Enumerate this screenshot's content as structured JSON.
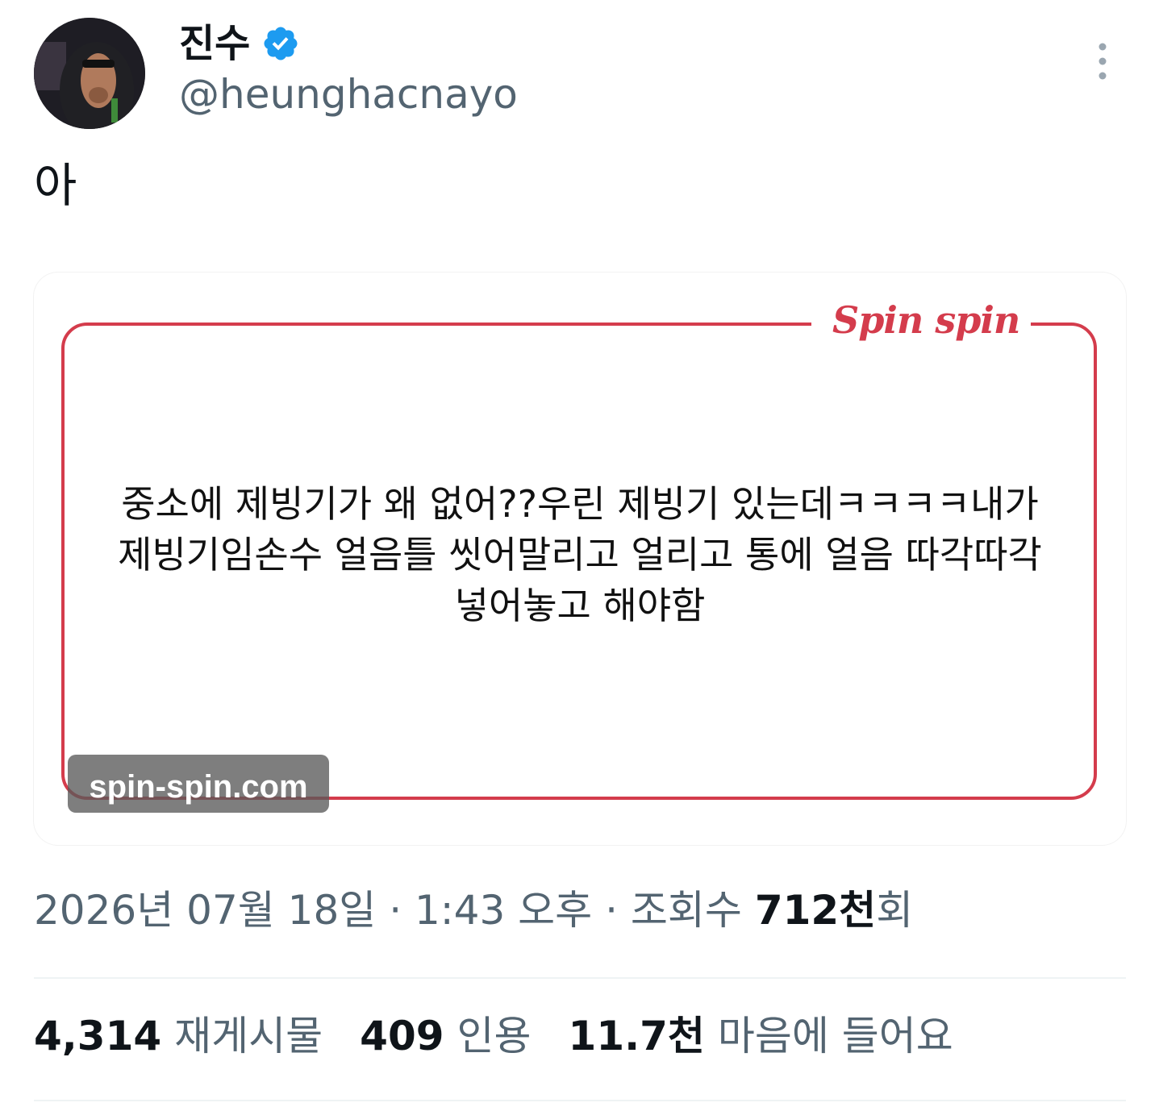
{
  "header": {
    "display_name": "진수",
    "handle": "@heunghacnayo"
  },
  "tweet": {
    "text": "아"
  },
  "media": {
    "logo": "Spin spin",
    "lines": [
      "중소에 제빙기가 왜 없어??우린 제빙기 있는데ㅋㅋㅋㅋ내가",
      "제빙기임손수 얼음틀 씻어말리고 얼리고 통에 얼음 따각따각",
      "넣어놓고 해야함"
    ],
    "watermark": "spin-spin.com",
    "frame_color": "#d43c4c"
  },
  "meta": {
    "date": "2026년 07월 18일",
    "time": "1:43 오후",
    "views_label": "조회수",
    "views_count": "712천",
    "views_suffix": "회",
    "separator": "·"
  },
  "stats": {
    "retweets_count": "4,314",
    "retweets_label": "재게시물",
    "quotes_count": "409",
    "quotes_label": "인용",
    "likes_count": "11.7천",
    "likes_label": "마음에 들어요"
  },
  "colors": {
    "verified": "#1d9bf0",
    "secondary_text": "#536471"
  }
}
